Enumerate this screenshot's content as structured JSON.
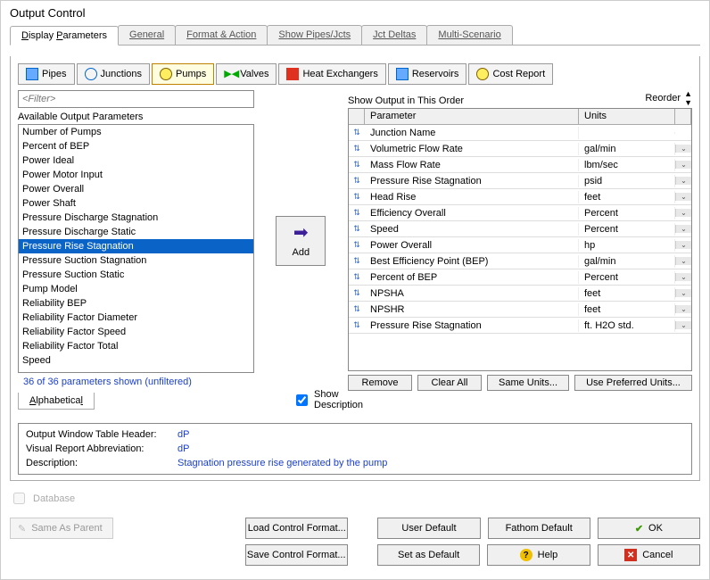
{
  "title": "Output Control",
  "tabs": [
    "Display Parameters",
    "General",
    "Format & Action",
    "Show Pipes/Jcts",
    "Jct Deltas",
    "Multi-Scenario"
  ],
  "active_tab": 0,
  "toolbtns": [
    {
      "name": "pipes",
      "label": "Pipes"
    },
    {
      "name": "junctions",
      "label": "Junctions"
    },
    {
      "name": "pumps",
      "label": "Pumps",
      "active": true
    },
    {
      "name": "valves",
      "label": "Valves"
    },
    {
      "name": "heat",
      "label": "Heat Exchangers"
    },
    {
      "name": "reservoirs",
      "label": "Reservoirs"
    },
    {
      "name": "cost",
      "label": "Cost Report"
    }
  ],
  "filter_placeholder": "<Filter>",
  "available_label": "Available Output Parameters",
  "available": [
    "Number of Pumps",
    "Percent of BEP",
    "Power Ideal",
    "Power Motor Input",
    "Power Overall",
    "Power Shaft",
    "Pressure Discharge Stagnation",
    "Pressure Discharge Static",
    "Pressure Rise Stagnation",
    "Pressure Suction Stagnation",
    "Pressure Suction Static",
    "Pump Model",
    "Reliability BEP",
    "Reliability Factor Diameter",
    "Reliability Factor Speed",
    "Reliability Factor Total",
    "Speed"
  ],
  "selected_index": 8,
  "shown_status": "36 of 36 parameters shown (unfiltered)",
  "alphabetical": "Alphabetical",
  "add_label": "Add",
  "show_desc": {
    "label1": "Show",
    "label2": "Description",
    "checked": true
  },
  "order_label": "Show Output in This Order",
  "reorder_label": "Reorder",
  "grid_headers": {
    "param": "Parameter",
    "units": "Units"
  },
  "grid_rows": [
    {
      "param": "Junction Name",
      "units": ""
    },
    {
      "param": "Volumetric Flow Rate",
      "units": "gal/min"
    },
    {
      "param": "Mass Flow Rate",
      "units": "lbm/sec"
    },
    {
      "param": "Pressure Rise Stagnation",
      "units": "psid"
    },
    {
      "param": "Head Rise",
      "units": "feet"
    },
    {
      "param": "Efficiency Overall",
      "units": "Percent"
    },
    {
      "param": "Speed",
      "units": "Percent"
    },
    {
      "param": "Power Overall",
      "units": "hp"
    },
    {
      "param": "Best Efficiency Point (BEP)",
      "units": "gal/min"
    },
    {
      "param": "Percent of BEP",
      "units": "Percent"
    },
    {
      "param": "NPSHA",
      "units": "feet"
    },
    {
      "param": "NPSHR",
      "units": "feet"
    },
    {
      "param": "Pressure Rise Stagnation",
      "units": "ft. H2O std."
    }
  ],
  "right_btns": [
    "Remove",
    "Clear All",
    "Same Units...",
    "Use Preferred Units..."
  ],
  "info": {
    "header_k": "Output Window Table Header:",
    "header_v": "dP",
    "abbrev_k": "Visual Report Abbreviation:",
    "abbrev_v": "dP",
    "desc_k": "Description:",
    "desc_v": "Stagnation pressure rise generated by the pump"
  },
  "database_label": "Database",
  "same_as_parent": "Same As Parent",
  "bottom_btns": {
    "load": "Load Control Format...",
    "save": "Save Control Format...",
    "userdef": "User Default",
    "setdef": "Set as Default",
    "fathom": "Fathom Default",
    "help": "Help",
    "ok": "OK",
    "cancel": "Cancel"
  }
}
